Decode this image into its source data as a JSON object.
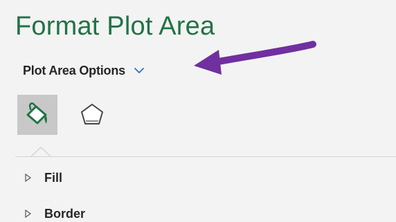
{
  "pane": {
    "title": "Format Plot Area",
    "options_label": "Plot Area Options",
    "chevron_icon": "chevron-down-icon",
    "tabs": [
      {
        "name": "fill-line-tab",
        "icon": "paint-bucket-icon",
        "selected": true
      },
      {
        "name": "effects-tab",
        "icon": "pentagon-icon",
        "selected": false
      }
    ],
    "sections": [
      {
        "label": "Fill",
        "icon": "expand-caret-icon"
      },
      {
        "label": "Border",
        "icon": "expand-caret-icon"
      }
    ]
  },
  "colors": {
    "title": "#217346",
    "chevron": "#2e75b6",
    "annotation_arrow": "#7030a0",
    "selected_tab_bg": "#c8c8c8",
    "bucket_green": "#217346"
  }
}
